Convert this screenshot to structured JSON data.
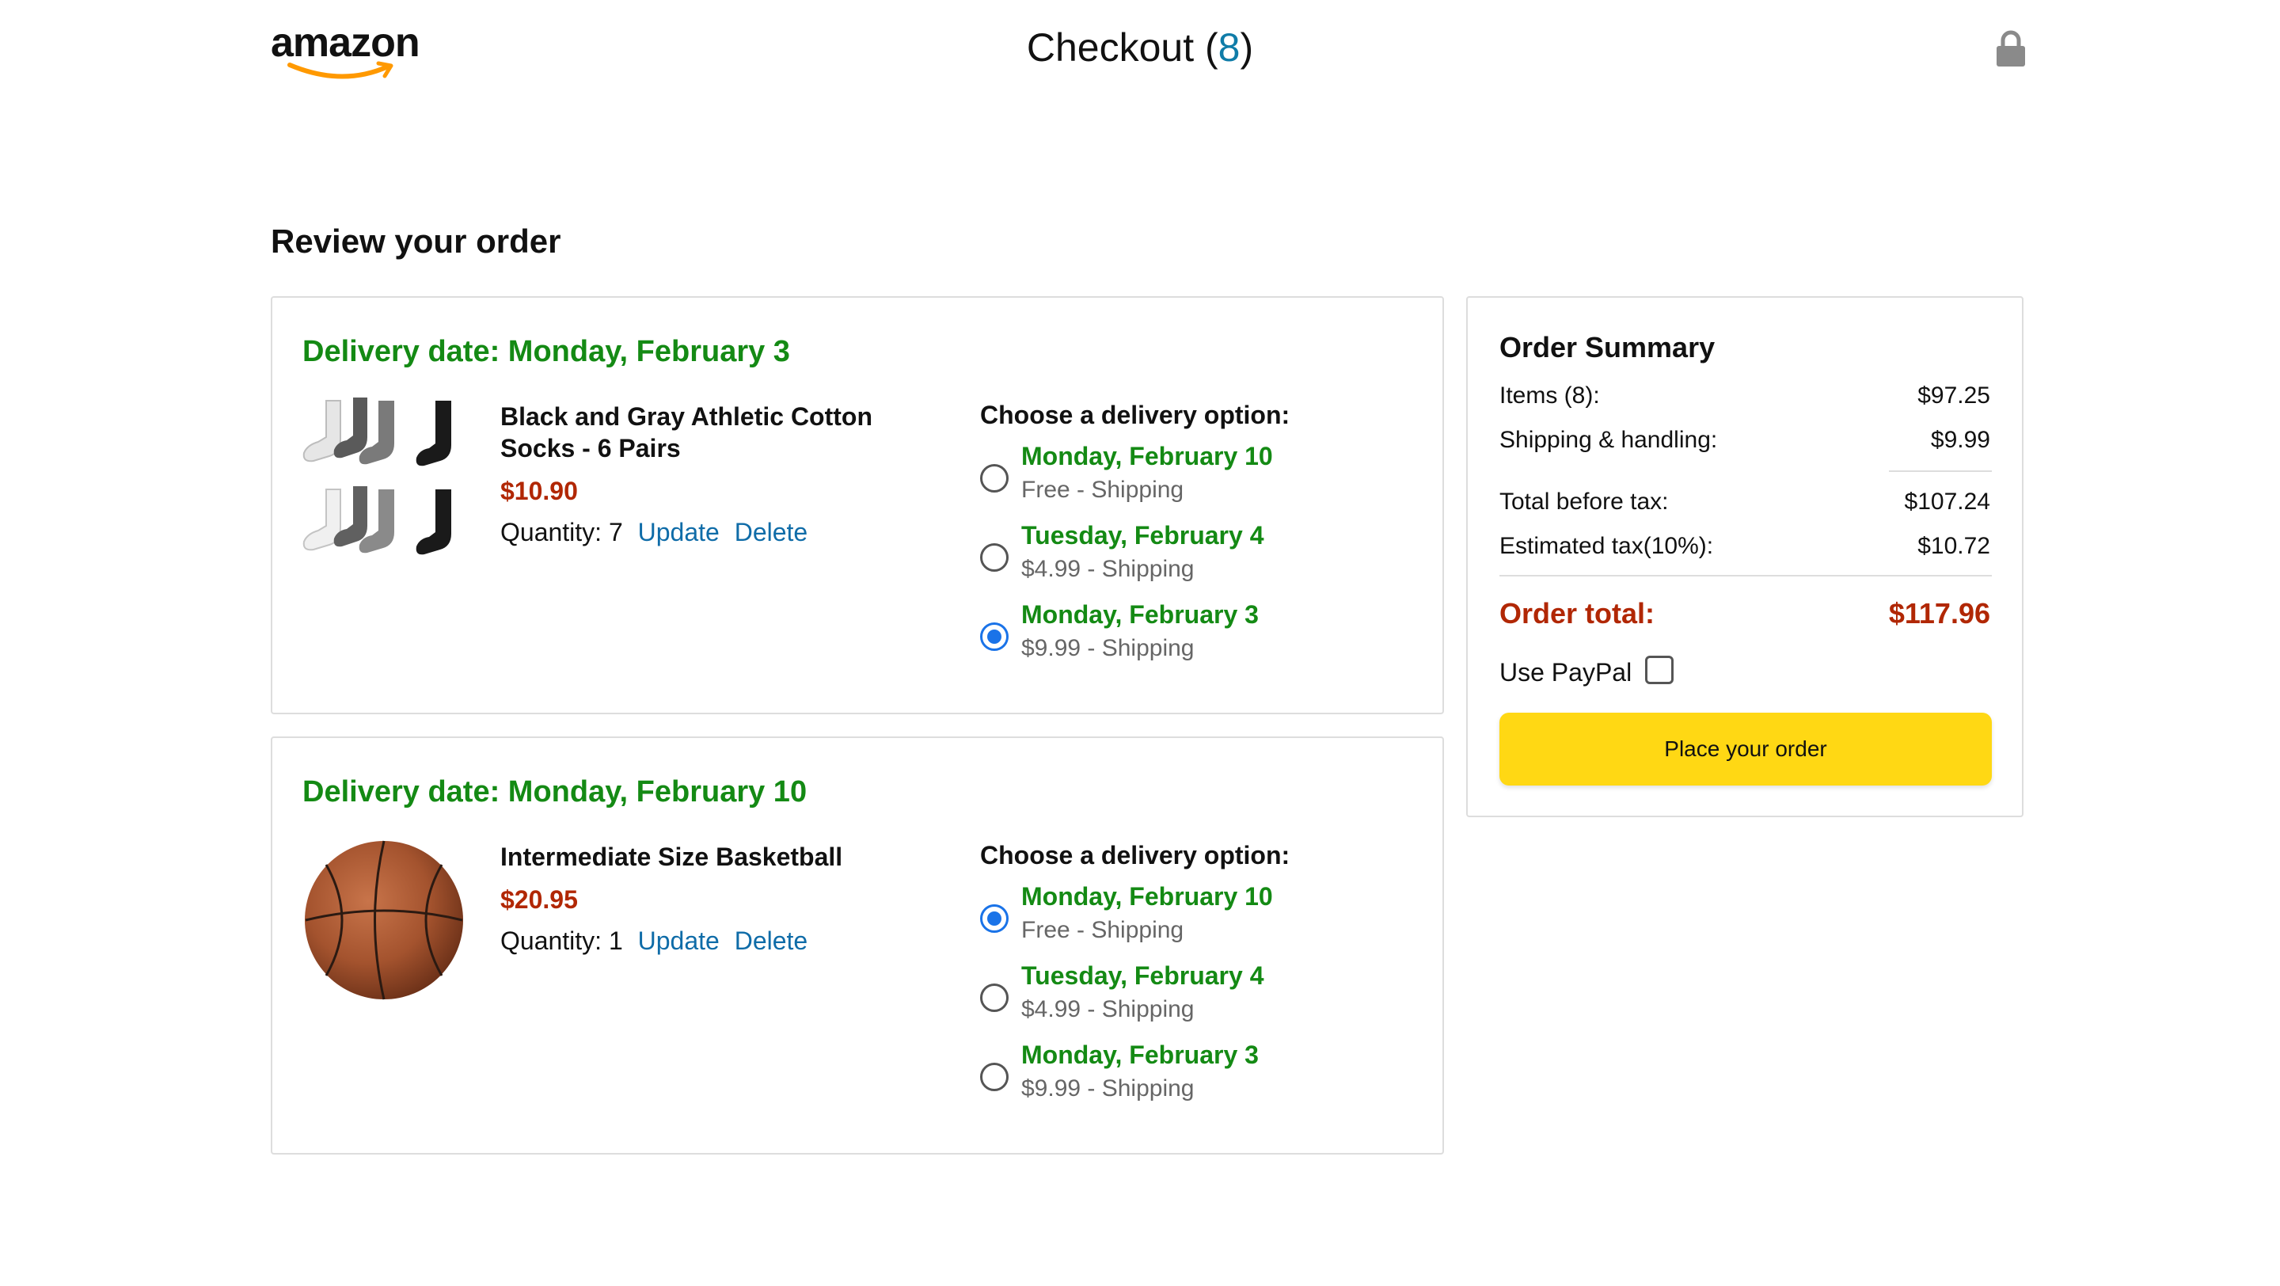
{
  "header": {
    "logo_text": "amazon",
    "title": "Checkout",
    "count_open": "(",
    "count": "8",
    "count_close": ")"
  },
  "page_title": "Review your order",
  "orders": [
    {
      "delivery_date": "Delivery date: Monday, February 3",
      "image": "socks-product-image",
      "name": "Black and Gray Athletic Cotton Socks - 6 Pairs",
      "price": "$10.90",
      "quantity": "Quantity: 7",
      "update": "Update",
      "delete": "Delete",
      "delivery_title": "Choose a delivery option:",
      "options": [
        {
          "date": "Monday, February 10",
          "price": "Free - Shipping",
          "selected": false
        },
        {
          "date": "Tuesday, February 4",
          "price": "$4.99 - Shipping",
          "selected": false
        },
        {
          "date": "Monday, February 3",
          "price": "$9.99 - Shipping",
          "selected": true
        }
      ]
    },
    {
      "delivery_date": "Delivery date: Monday, February 10",
      "image": "basketball-product-image",
      "name": "Intermediate Size Basketball",
      "price": "$20.95",
      "quantity": "Quantity: 1",
      "update": "Update",
      "delete": "Delete",
      "delivery_title": "Choose a delivery option:",
      "options": [
        {
          "date": "Monday, February 10",
          "price": "Free - Shipping",
          "selected": true
        },
        {
          "date": "Tuesday, February 4",
          "price": "$4.99 - Shipping",
          "selected": false
        },
        {
          "date": "Monday, February 3",
          "price": "$9.99 - Shipping",
          "selected": false
        }
      ]
    }
  ],
  "summary": {
    "title": "Order Summary",
    "items_label": "Items (8):",
    "items_value": "$97.25",
    "shipping_label": "Shipping & handling:",
    "shipping_value": "$9.99",
    "before_tax_label": "Total before tax:",
    "before_tax_value": "$107.24",
    "tax_label": "Estimated tax(10%):",
    "tax_value": "$10.72",
    "total_label": "Order total:",
    "total_value": "$117.96",
    "paypal_label": "Use PayPal",
    "paypal_checked": false,
    "place_order": "Place your order"
  },
  "colors": {
    "accent_green": "#148a14",
    "price_red": "#B12704",
    "link_blue": "#0F6CA8",
    "button_yellow": "#FFD814",
    "radio_blue": "#1a73e8"
  },
  "icons": [
    "amazon-logo",
    "lock-icon"
  ]
}
